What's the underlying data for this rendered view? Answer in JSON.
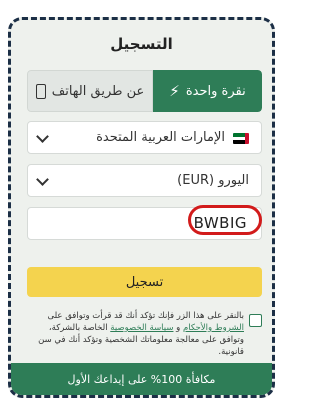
{
  "form": {
    "title": "التسجيل",
    "tabs": {
      "phone_label": "عن طريق الهاتف",
      "phone_icon": "phone-icon",
      "oneclick_label": "نقرة واحدة",
      "oneclick_icon": "lightning-icon"
    },
    "country_select": {
      "value": "الإمارات العربية المتحدة",
      "flag": "uae-flag-icon"
    },
    "currency_select": {
      "value": "اليورو (EUR)"
    },
    "promo_code": {
      "value": "BWBIG"
    },
    "register_button": "تسجيل",
    "terms": {
      "text_before": "بالنقر على هذا الزر فإنك تؤكد أنك قد قرأت وتوافق على ",
      "link_terms": "الشروط والأحكام",
      "text_and": " و ",
      "link_privacy": "سياسة الخصوصية",
      "text_after": " الخاصة بالشركة، وتوافق على معالجة معلوماتك الشخصية وتؤكد أنك في سن قانونية."
    },
    "bonus_bar": "مكافأة 100% على إيداعك الأول"
  },
  "colors": {
    "accent_green": "#2e7d57",
    "button_yellow": "#f4d34e",
    "highlight_red": "#d21b1b",
    "card_bg": "#eef1ed",
    "dashed_border": "#1c2f46"
  }
}
